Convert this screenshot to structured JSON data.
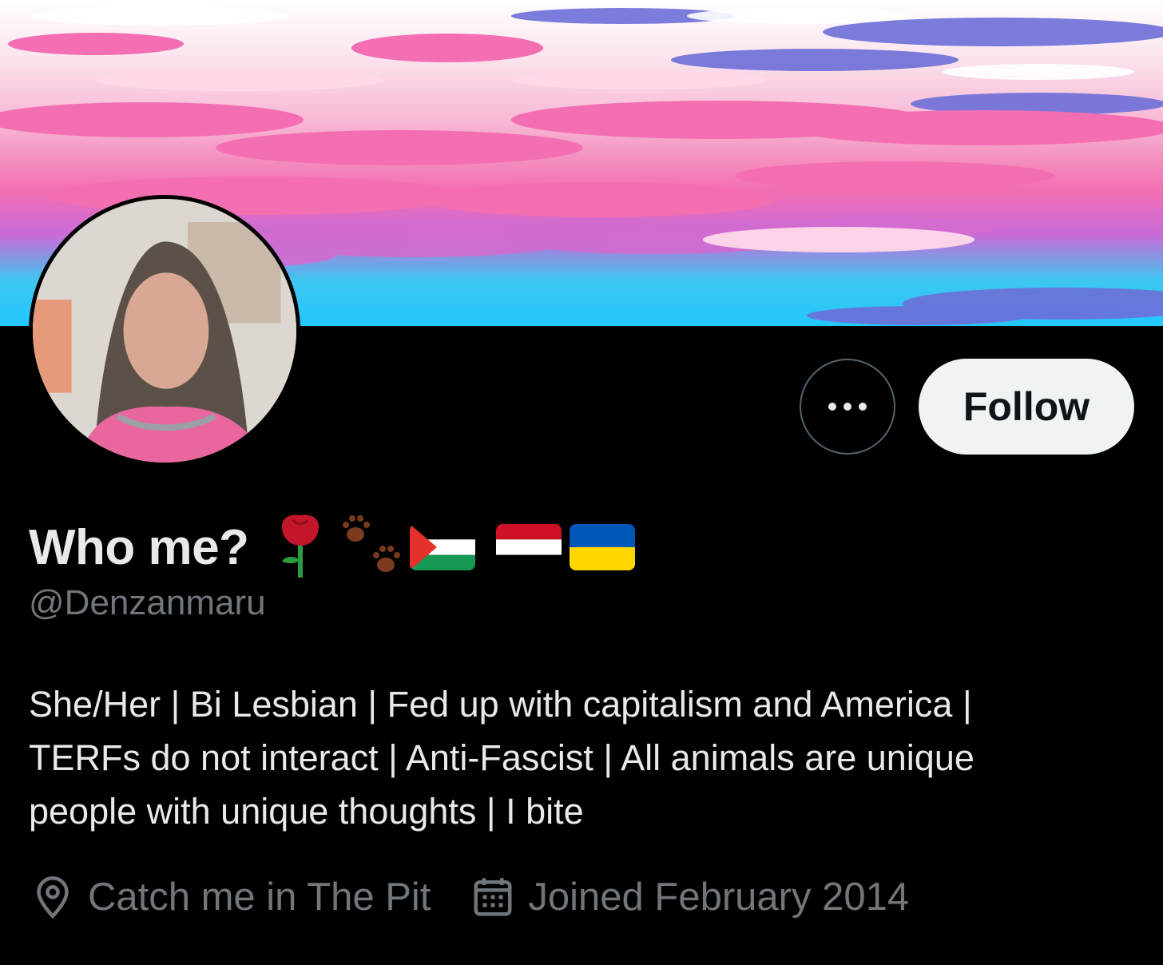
{
  "profile": {
    "display_name": "Who me?",
    "emoji_rose": "rose-emoji",
    "emoji_paws": "paw-prints-emoji",
    "flags": [
      "flag-palestine",
      "flag-yemen",
      "flag-ukraine"
    ],
    "handle": "@Denzanmaru",
    "bio_lines": [
      "She/Her | Bi Lesbian | Fed up with capitalism and America |",
      "TERFs do not interact | Anti-Fascist | All animals are unique",
      "people with unique thoughts | I bite"
    ],
    "location": "Catch me in The Pit",
    "joined": "Joined February 2014"
  },
  "actions": {
    "more_icon": "more-horizontal-icon",
    "follow_label": "Follow"
  },
  "colors": {
    "background": "#000000",
    "text_primary": "#e7e9ea",
    "text_secondary": "#71767b",
    "follow_bg": "#eff3f4",
    "follow_text": "#0f1419"
  }
}
